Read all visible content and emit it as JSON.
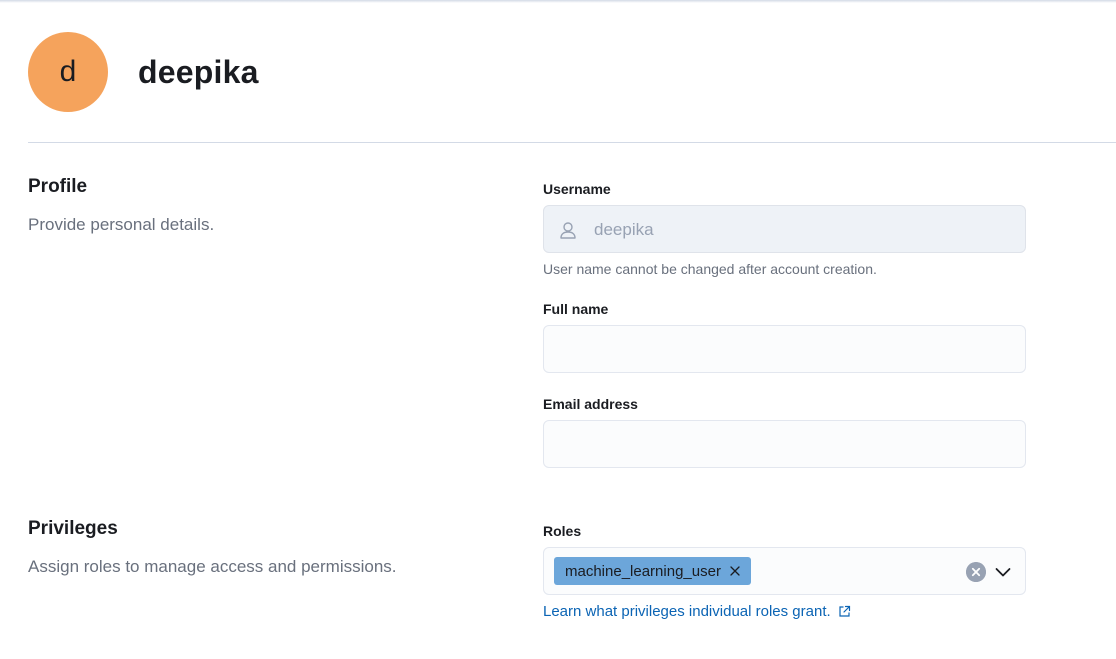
{
  "header": {
    "avatar_initial": "d",
    "username": "deepika"
  },
  "profile": {
    "title": "Profile",
    "description": "Provide personal details.",
    "username_label": "Username",
    "username_value": "deepika",
    "username_help": "User name cannot be changed after account creation.",
    "fullname_label": "Full name",
    "fullname_value": "",
    "email_label": "Email address",
    "email_value": ""
  },
  "privileges": {
    "title": "Privileges",
    "description": "Assign roles to manage access and permissions.",
    "roles_label": "Roles",
    "selected_roles": [
      "machine_learning_user"
    ],
    "help_link": "Learn what privileges individual roles grant."
  },
  "colors": {
    "avatar_bg": "#f5a35c",
    "role_pill_bg": "#6ca6da",
    "link": "#0b64b4"
  },
  "icons": {
    "username_field": "user-icon",
    "pill_remove": "close-icon",
    "clear": "clear-icon",
    "dropdown": "chevron-down-icon",
    "external": "external-link-icon"
  }
}
